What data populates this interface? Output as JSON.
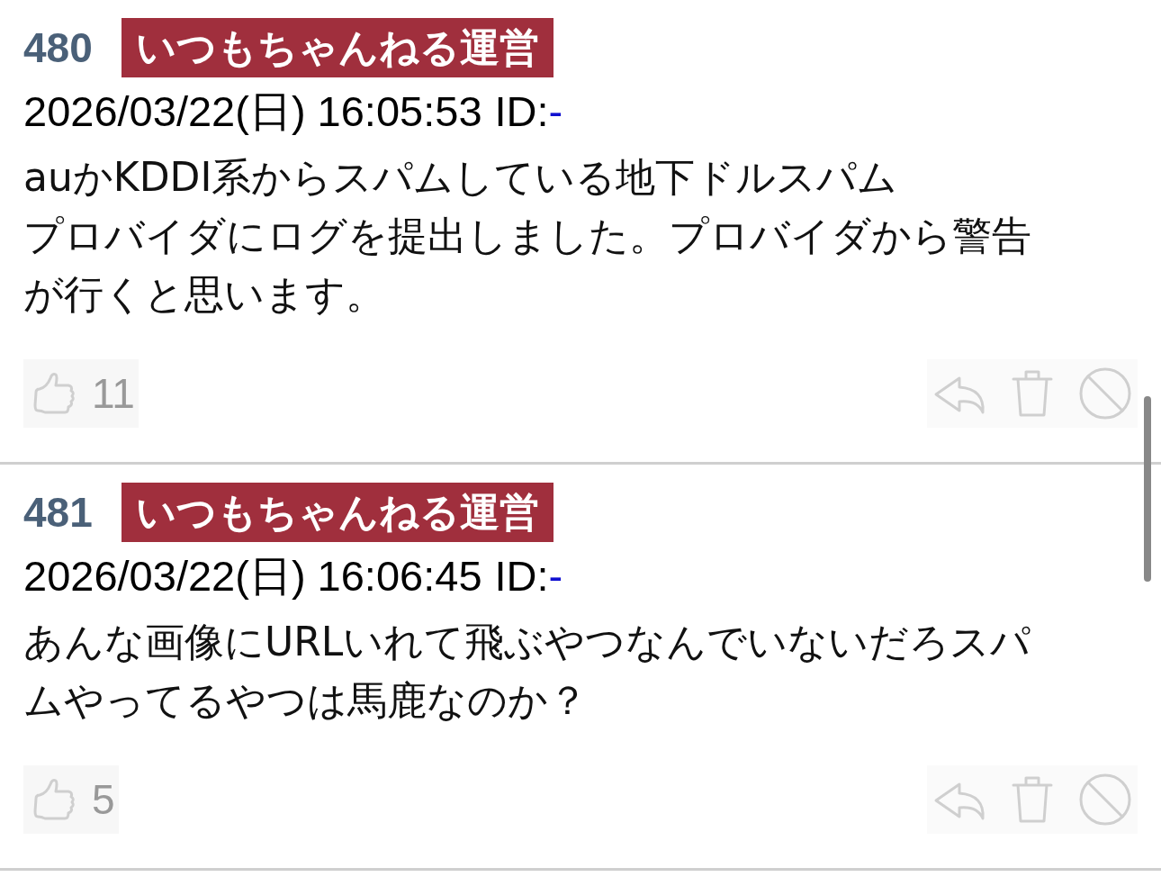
{
  "posts": [
    {
      "number": "480",
      "name": "いつもちゃんねる運営",
      "date": "2026/03/22(日) 16:05:53",
      "id_label": "ID:",
      "id": "-",
      "body": [
        "auかKDDI系からスパムしている地下ドルスパム",
        "プロバイダにログを提出しました。プロバイダから警告",
        "が行くと思います。"
      ],
      "likes": "11"
    },
    {
      "number": "481",
      "name": "いつもちゃんねる運営",
      "date": "2026/03/22(日) 16:06:45",
      "id_label": "ID:",
      "id": "-",
      "body": [
        "あんな画像にURLいれて飛ぶやつなんでいないだろスパ",
        "ムやってるやつは馬鹿なのか？"
      ],
      "likes": "5"
    }
  ]
}
